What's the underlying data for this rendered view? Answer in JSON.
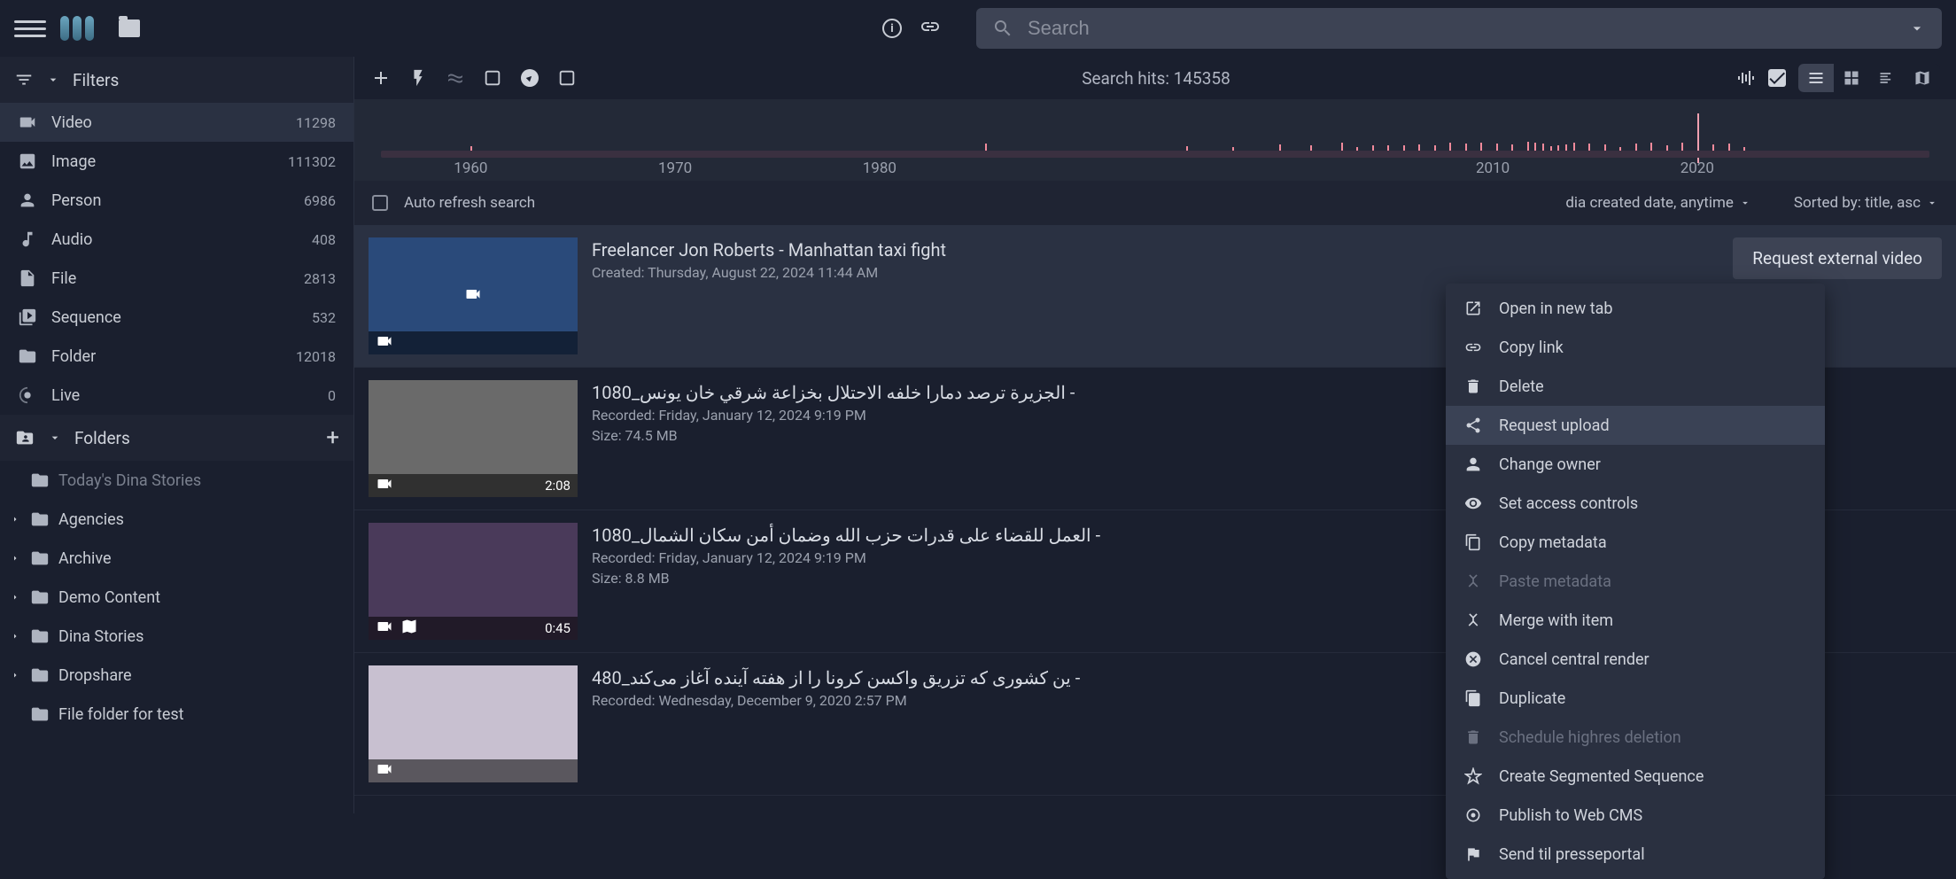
{
  "search": {
    "placeholder": "Search"
  },
  "sidebar": {
    "filters_title": "Filters",
    "filters": [
      {
        "label": "Video",
        "count": "11298",
        "icon": "video"
      },
      {
        "label": "Image",
        "count": "111302",
        "icon": "image"
      },
      {
        "label": "Person",
        "count": "6986",
        "icon": "person"
      },
      {
        "label": "Audio",
        "count": "408",
        "icon": "audio"
      },
      {
        "label": "File",
        "count": "2813",
        "icon": "file"
      },
      {
        "label": "Sequence",
        "count": "532",
        "icon": "sequence"
      },
      {
        "label": "Folder",
        "count": "12018",
        "icon": "folder"
      },
      {
        "label": "Live",
        "count": "0",
        "icon": "live"
      }
    ],
    "folders_title": "Folders",
    "folders": [
      {
        "label": "Today's Dina Stories",
        "expandable": false,
        "subtle": true
      },
      {
        "label": "Agencies",
        "expandable": true
      },
      {
        "label": "Archive",
        "expandable": true
      },
      {
        "label": "Demo Content",
        "expandable": true
      },
      {
        "label": "Dina Stories",
        "expandable": true
      },
      {
        "label": "Dropshare",
        "expandable": true
      },
      {
        "label": "File folder for test",
        "expandable": false
      }
    ]
  },
  "toolbar": {
    "search_hits": "Search hits: 145358"
  },
  "timeline": {
    "labels": [
      "1960",
      "1970",
      "1980",
      "2010",
      "2020"
    ],
    "label_positions": [
      5.8,
      19.0,
      32.2,
      71.8,
      85.0
    ]
  },
  "filterbar": {
    "auto_refresh": "Auto refresh search",
    "date_filter": "dia created date, anytime",
    "sort": "Sorted by: title, asc"
  },
  "context_menu": [
    {
      "label": "Open in new tab",
      "icon": "open"
    },
    {
      "label": "Copy link",
      "icon": "link"
    },
    {
      "label": "Delete",
      "icon": "trash"
    },
    {
      "label": "Request upload",
      "icon": "share",
      "highlight": true
    },
    {
      "label": "Change owner",
      "icon": "person"
    },
    {
      "label": "Set access controls",
      "icon": "eye"
    },
    {
      "label": "Copy metadata",
      "icon": "copy"
    },
    {
      "label": "Paste metadata",
      "icon": "merge",
      "disabled": true
    },
    {
      "label": "Merge with item",
      "icon": "merge"
    },
    {
      "label": "Cancel central render",
      "icon": "cancel"
    },
    {
      "label": "Duplicate",
      "icon": "dup"
    },
    {
      "label": "Schedule highres deletion",
      "icon": "trash",
      "disabled": true
    },
    {
      "label": "Create Segmented Sequence",
      "icon": "star"
    },
    {
      "label": "Publish to Web CMS",
      "icon": "target"
    },
    {
      "label": "Send til presseportal",
      "icon": "flag"
    }
  ],
  "items": [
    {
      "title": "Freelancer Jon Roberts - Manhattan taxi fight",
      "created": "Created: Thursday, August 22, 2024 11:44 AM",
      "thumb": "blue",
      "action": "Request external video",
      "selected": true
    },
    {
      "title": "الجزيرة ترصد دمارا خلفه الاحتلال بخزاعة شرقي خان يونس_1080 -",
      "recorded": "Recorded: Friday, January 12, 2024 9:19 PM",
      "size": "Size: 74.5 MB",
      "duration": "2:08",
      "thumb": "grey",
      "has_map": false
    },
    {
      "title": "العمل للقضاء على قدرات حزب الله وضمان أمن سكان الشمال_1080 -",
      "recorded": "Recorded: Friday, January 12, 2024 9:19 PM",
      "size": "Size: 8.8 MB",
      "duration": "0:45",
      "thumb": "news",
      "has_map": true
    },
    {
      "title": "ین کشوری که تزریق واکسن کرونا را از هفته آینده آغاز می‌کند_480 -",
      "recorded": "Recorded: Wednesday, December 9, 2020 2:57 PM",
      "thumb": "light"
    }
  ]
}
